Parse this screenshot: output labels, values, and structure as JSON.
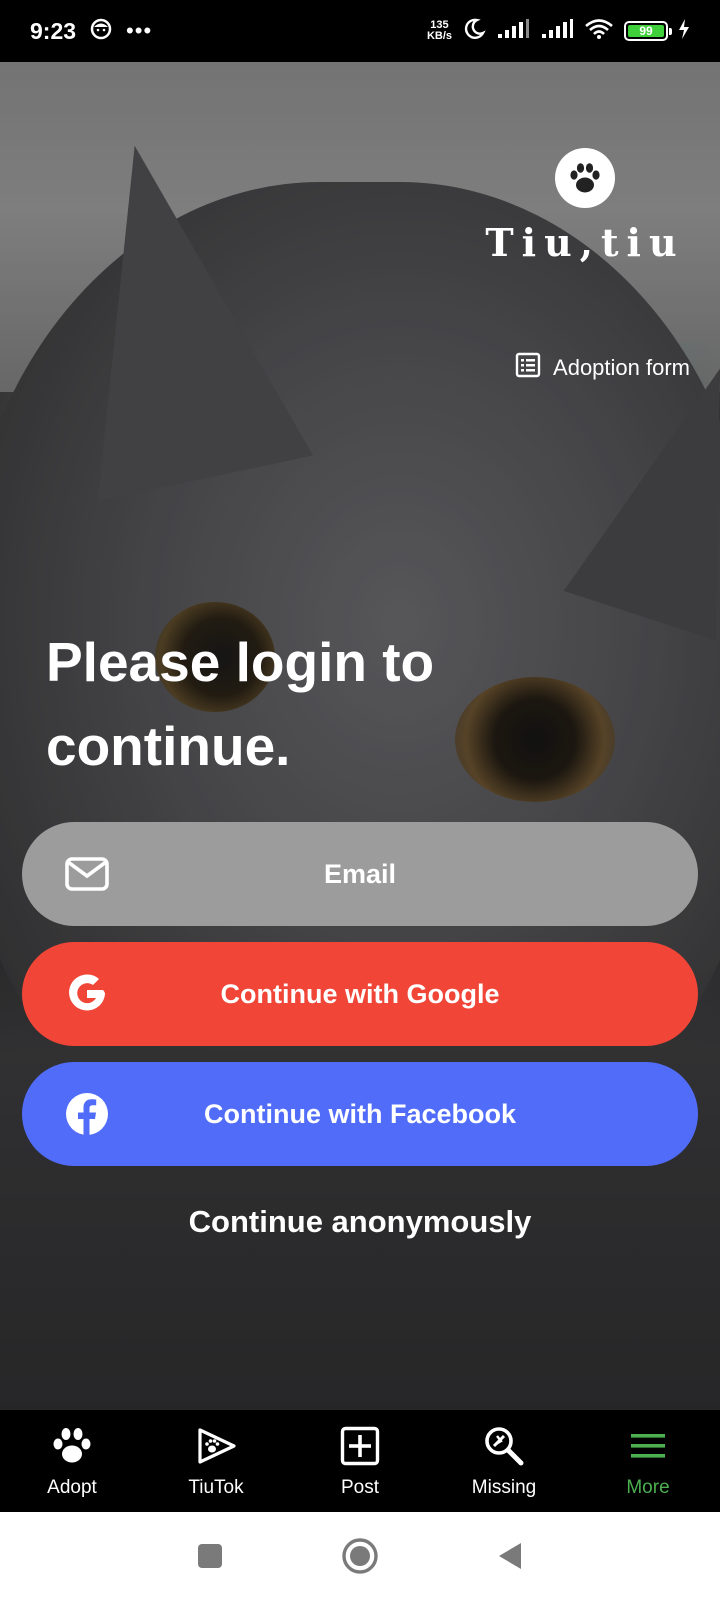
{
  "status_bar": {
    "time": "9:23",
    "dots": "•••",
    "net_speed_value": "135",
    "net_speed_unit": "KB/s",
    "battery_level": "99"
  },
  "header": {
    "logo_text": "Tiu,tiu",
    "adoption_form_label": "Adoption form"
  },
  "main": {
    "heading": "Please login to continue.",
    "email_button_label": "Email",
    "google_button_label": "Continue with Google",
    "facebook_button_label": "Continue with Facebook",
    "anonymous_label": "Continue anonymously"
  },
  "colors": {
    "email_button": "#9c9c9c",
    "google_button": "#f04537",
    "facebook_button": "#506cf8",
    "active_nav": "#4caf50"
  },
  "bottom_nav": {
    "items": [
      {
        "label": "Adopt",
        "icon": "paw-icon",
        "active": false
      },
      {
        "label": "TiuTok",
        "icon": "play-paw-icon",
        "active": false
      },
      {
        "label": "Post",
        "icon": "add-box-icon",
        "active": false
      },
      {
        "label": "Missing",
        "icon": "search-missing-icon",
        "active": false
      },
      {
        "label": "More",
        "icon": "menu-icon",
        "active": true
      }
    ]
  },
  "system_nav": {
    "icons": [
      "recents-icon",
      "home-icon",
      "back-icon"
    ]
  }
}
